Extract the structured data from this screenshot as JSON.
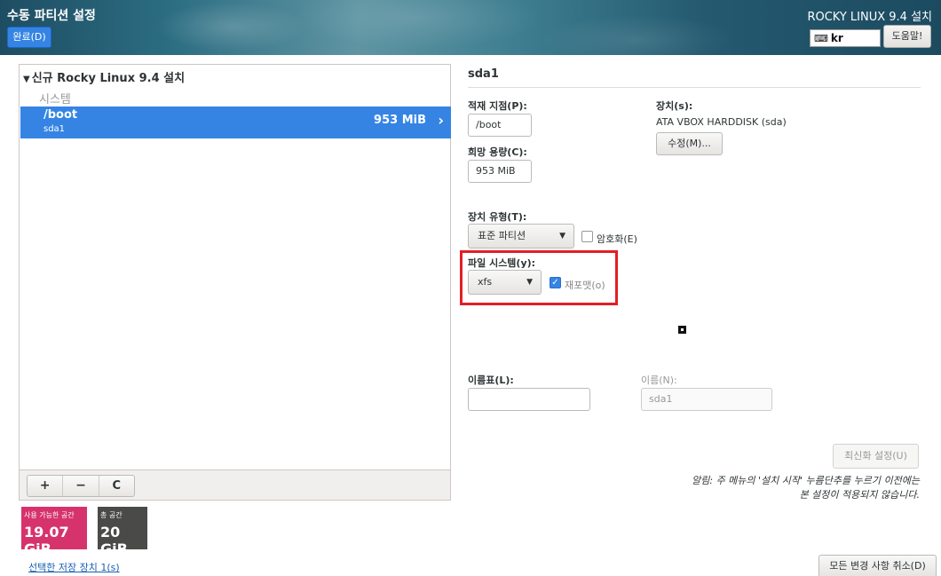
{
  "header": {
    "title": "수동 파티션 설정",
    "done_button": "완료(D)",
    "product_title": "ROCKY LINUX 9.4 설치",
    "keyboard_layout": "kr",
    "help_button": "도움말!"
  },
  "tree": {
    "title": "신규 Rocky Linux 9.4 설치",
    "group_label": "시스템",
    "partitions": [
      {
        "mount": "/boot",
        "device": "sda1",
        "size": "953 MiB",
        "selected": true
      }
    ]
  },
  "toolbar": {
    "add": "+",
    "remove": "−",
    "refresh": "C"
  },
  "space": {
    "available_label": "사용 가능한 공간",
    "available_value": "19.07 GiB",
    "total_label": "총 공간",
    "total_value": "20 GiB"
  },
  "storage_link": "선택한 저장 장치 1(s)",
  "detail": {
    "title": "sda1",
    "mount_point_label": "적재 지점(P):",
    "mount_point_value": "/boot",
    "desired_capacity_label": "희망 용량(C):",
    "desired_capacity_value": "953 MiB",
    "devices_label": "장치(s):",
    "devices_value": "ATA VBOX HARDDISK (sda)",
    "modify_button": "수정(M)...",
    "device_type_label": "장치 유형(T):",
    "device_type_value": "표준 파티션",
    "encrypt_label": "암호화(E)",
    "encrypt_checked": false,
    "filesystem_label": "파일 시스템(y):",
    "filesystem_value": "xfs",
    "reformat_label": "재포맷(o)",
    "reformat_checked": true,
    "label_label": "이름표(L):",
    "label_value": "",
    "name_label": "이름(N):",
    "name_value": "sda1",
    "update_button": "최신화 설정(U)",
    "note": "알림: 주 메뉴의 '설치 시작' 누름단추를 누르기 이전에는 본 설정이 적용되지 않습니다.",
    "discard_button": "모든 변경 사항 취소(D)"
  },
  "colors": {
    "accent": "#3584e4",
    "available_space": "#d6336c",
    "total_space": "#4a4a48",
    "highlight_box": "#e31e24"
  }
}
